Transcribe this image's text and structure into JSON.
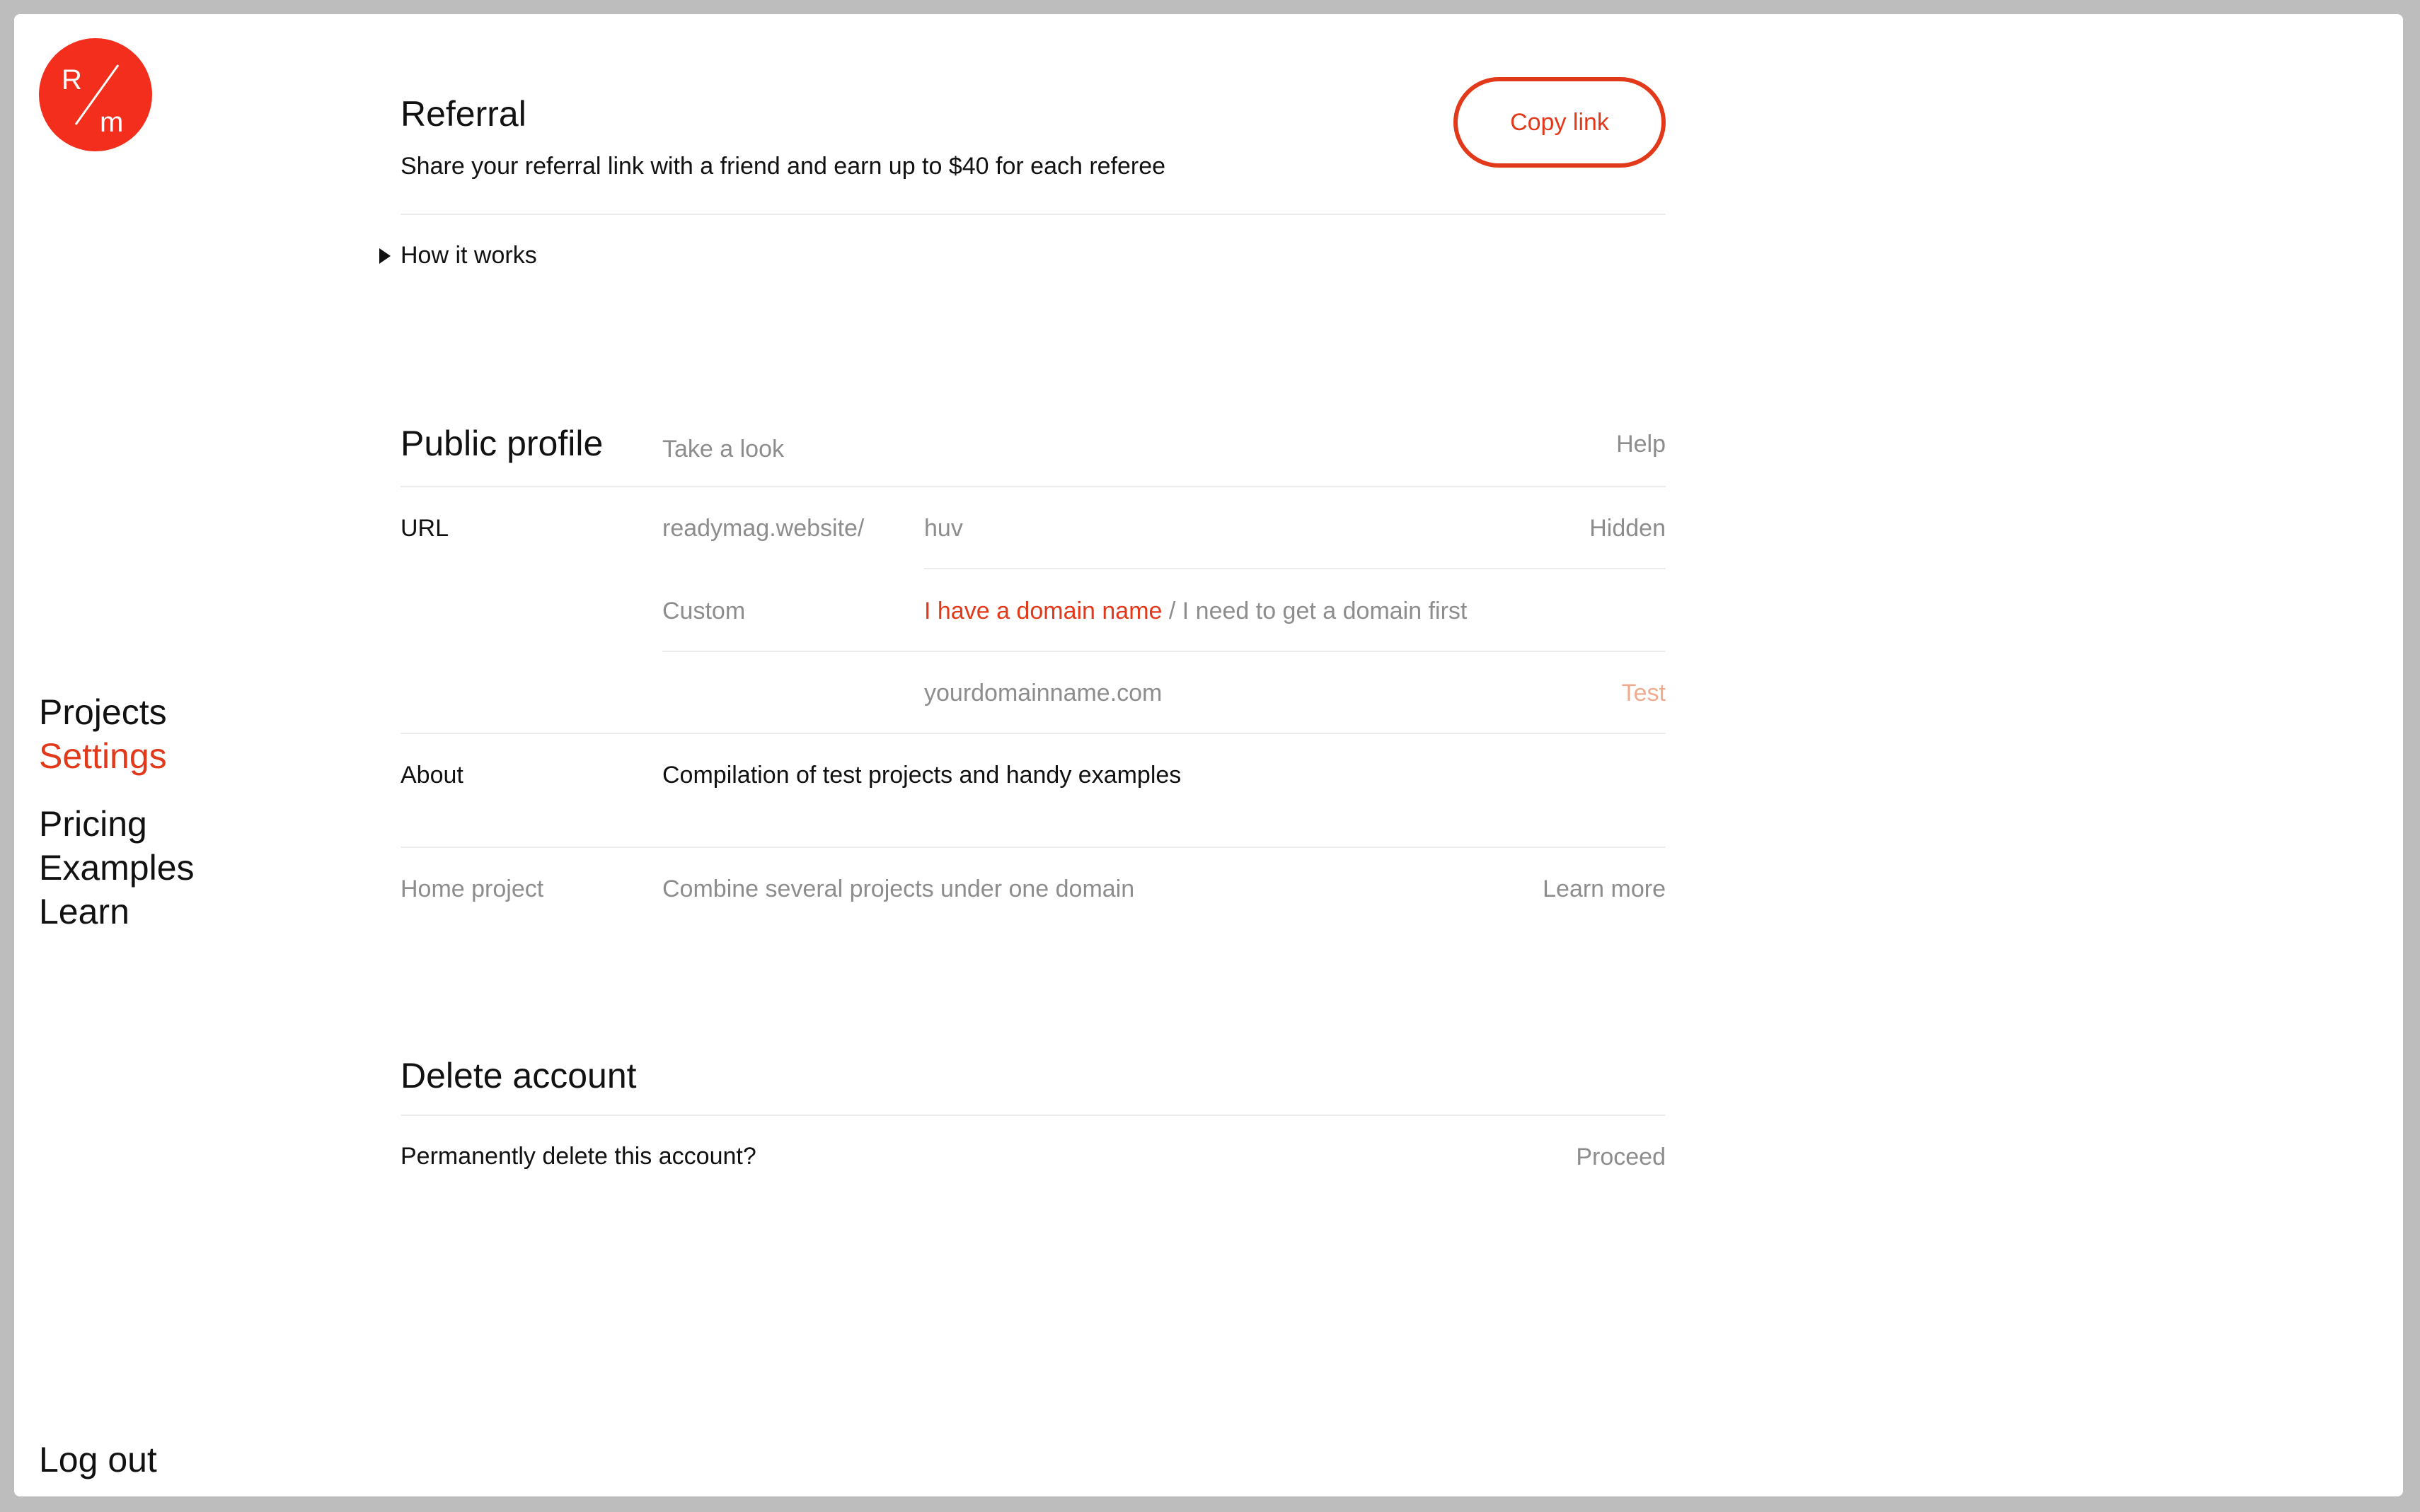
{
  "sidebar": {
    "nav": [
      {
        "label": "Projects",
        "active": false
      },
      {
        "label": "Settings",
        "active": true
      },
      {
        "label": "Pricing",
        "active": false
      },
      {
        "label": "Examples",
        "active": false
      },
      {
        "label": "Learn",
        "active": false
      }
    ],
    "logout": "Log out",
    "logo": {
      "letters": [
        "R",
        "m"
      ],
      "color": "#f42e1c"
    }
  },
  "referral": {
    "title": "Referral",
    "subtitle": "Share your referral link with a friend and earn up to $40 for each referee",
    "copy_button": "Copy link",
    "how_it_works": "How it works"
  },
  "public_profile": {
    "title": "Public profile",
    "take_a_look": "Take a look",
    "help": "Help",
    "url": {
      "label": "URL",
      "prefix": "readymag.website/",
      "value": "huv",
      "visibility": "Hidden"
    },
    "custom": {
      "label": "Custom",
      "option_active": "I have a domain name",
      "separator": " / ",
      "option_inactive": "I need to get a domain first",
      "placeholder": "yourdomainname.com",
      "test": "Test"
    },
    "about": {
      "label": "About",
      "value": "Compilation of test projects and handy examples"
    },
    "home_project": {
      "label": "Home project",
      "description": "Combine several projects under one domain",
      "learn_more": "Learn more"
    }
  },
  "delete_account": {
    "title": "Delete account",
    "question": "Permanently delete this account?",
    "proceed": "Proceed"
  },
  "colors": {
    "accent": "#e2391b",
    "logo": "#f42e1c",
    "muted": "#8d8d8d",
    "test_link": "#f0ab8f"
  }
}
